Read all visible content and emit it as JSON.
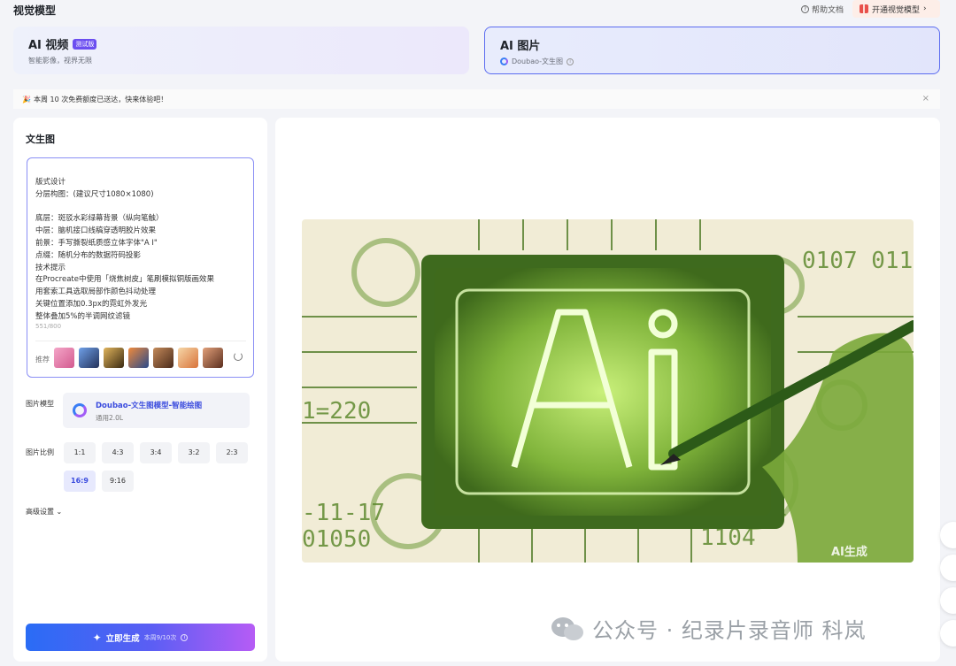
{
  "header": {
    "title": "视觉模型",
    "help_label": "帮助文档",
    "upgrade_label": "开通视觉模型",
    "upgrade_chevron": "›"
  },
  "cards": {
    "video": {
      "title": "AI 视频",
      "badge": "测试版",
      "subtitle": "智能影像，视界无限"
    },
    "image": {
      "title": "AI 图片",
      "subtitle": "Doubao-文生图"
    }
  },
  "notice": {
    "emoji": "🎉",
    "text": "本周 10 次免费额度已送达，快来体验吧！",
    "close": "×"
  },
  "left_panel": {
    "title": "文生图",
    "prompt": "版式设计\n分层构图：(建议尺寸1080×1080)\n\n底层：斑驳水彩绿幕背景（纵向笔触）\n中层：脑机接口线稿穿透明胶片效果\n前景：手写撕裂纸质感立体字体\"A I\"\n点缀：随机分布的数据符码投影\n技术提示\n在Procreate中使用「烧焦树皮」笔刷模拟铜版画效果\n用套索工具选取局部作颜色抖动处理\n关键位置添加0.3px的霓虹外发光\n整体叠加5%的半调网纹滤镜",
    "char_count": "551/800",
    "recommend_label": "推荐",
    "model_label": "图片模型",
    "model_name": "Doubao-文生图模型-智能绘图",
    "model_version": "通用2.0L",
    "ratio_label": "图片比例",
    "ratios": [
      "1:1",
      "4:3",
      "3:4",
      "3:2",
      "2:3",
      "16:9",
      "9:16"
    ],
    "selected_ratio": "16:9",
    "advanced_label": "高级设置",
    "generate_label": "立即生成",
    "quota_label": "本周9/10次"
  },
  "result": {
    "ai_mark": "AI生成",
    "watermark": "公众号 · 纪录片录音师 科岚"
  },
  "colors": {
    "accent": "#5b6cf0",
    "brand_blue": "#3b4cde",
    "art_green": "#5c8f2e"
  }
}
